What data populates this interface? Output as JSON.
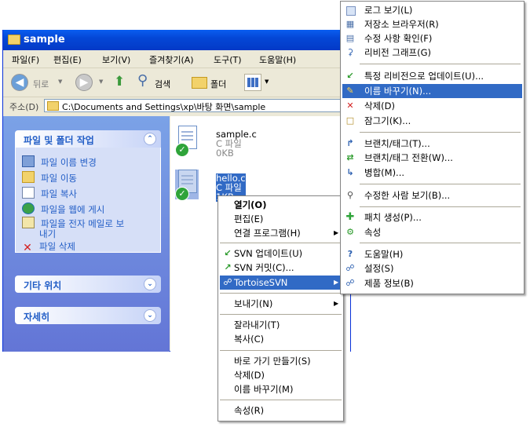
{
  "window": {
    "title": "sample",
    "menu": [
      "파일(F)",
      "편집(E)",
      "보기(V)",
      "즐겨찾기(A)",
      "도구(T)",
      "도움말(H)"
    ],
    "toolbar": {
      "back": "뒤로",
      "search": "검색",
      "folders": "폴더"
    },
    "address_label": "주소(D)",
    "address_value": "C:\\Documents and Settings\\xp\\바탕 화면\\sample"
  },
  "leftpane": {
    "tasks_title": "파일 및 폴더 작업",
    "tasks": [
      {
        "label": "파일 이름 변경",
        "icon": "rename-icon"
      },
      {
        "label": "파일 이동",
        "icon": "move-icon"
      },
      {
        "label": "파일 복사",
        "icon": "copy-icon"
      },
      {
        "label": "파일을 웹에 게시",
        "icon": "globe-icon"
      },
      {
        "label": "파일을 전자 메일로 보",
        "label2": "내기",
        "icon": "mail-icon"
      },
      {
        "label": "파일 삭제",
        "icon": "delete-icon"
      }
    ],
    "other_places": "기타 위치",
    "details": "자세히"
  },
  "files": [
    {
      "name": "sample.c",
      "type": "C 파일",
      "size": "0KB",
      "selected": false
    },
    {
      "name": "hello.c",
      "type": "C 파일",
      "size": "1KB",
      "selected": true
    }
  ],
  "context_menu": {
    "open": "열기(O)",
    "edit": "편집(E)",
    "open_with": "연결 프로그램(H)",
    "svn_update": "SVN 업데이트(U)",
    "svn_commit": "SVN 커밋(C)...",
    "tortoise": "TortoiseSVN",
    "send_to": "보내기(N)",
    "cut": "잘라내기(T)",
    "copy": "복사(C)",
    "create_shortcut": "바로 가기 만들기(S)",
    "delete": "삭제(D)",
    "rename": "이름 바꾸기(M)",
    "properties": "속성(R)"
  },
  "submenu": {
    "items": [
      "로그 보기(L)",
      "저장소 브라우저(R)",
      "수정 사항 확인(F)",
      "리비전 그래프(G)",
      "특정 리비전으로 업데이트(U)...",
      "이름 바꾸기(N)...",
      "삭제(D)",
      "잠그기(K)...",
      "브랜치/태그(T)...",
      "브랜치/태그 전환(W)...",
      "병합(M)...",
      "수정한 사람 보기(B)...",
      "패치 생성(P)...",
      "속성",
      "도움말(H)",
      "설정(S)",
      "제품 정보(B)"
    ],
    "highlighted_index": 5
  },
  "colors": {
    "highlight": "#316AC5",
    "titlebar": "#0447D6",
    "task_link": "#215DC6"
  }
}
